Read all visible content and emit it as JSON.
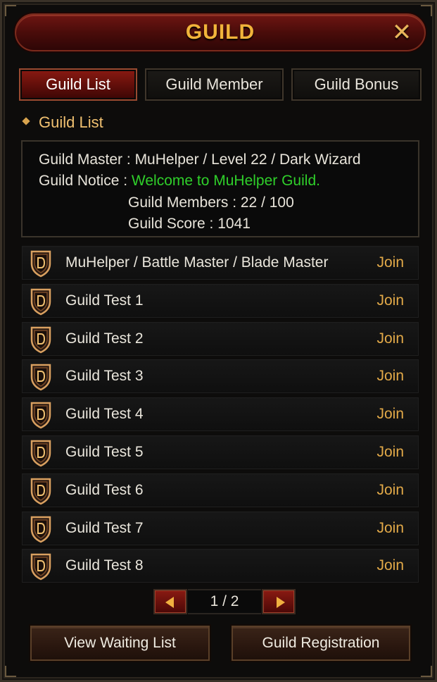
{
  "window": {
    "title": "GUILD",
    "close_symbol": "✕"
  },
  "tabs": [
    {
      "label": "Guild List",
      "active": true
    },
    {
      "label": "Guild Member",
      "active": false
    },
    {
      "label": "Guild Bonus",
      "active": false
    }
  ],
  "section": {
    "title": "Guild List"
  },
  "info": {
    "master_label": "Guild Master :",
    "master_value": "MuHelper / Level 22 / Dark Wizard",
    "notice_label": "Guild Notice :",
    "notice_value": "Welcome to MuHelper Guild.",
    "members_text": "Guild Members : 22 / 100",
    "score_text": "Guild Score : 1041"
  },
  "guilds": [
    {
      "name": "MuHelper / Battle Master / Blade Master",
      "action": "Join"
    },
    {
      "name": "Guild Test 1",
      "action": "Join"
    },
    {
      "name": "Guild Test 2",
      "action": "Join"
    },
    {
      "name": "Guild Test 3",
      "action": "Join"
    },
    {
      "name": "Guild Test 4",
      "action": "Join"
    },
    {
      "name": "Guild Test 5",
      "action": "Join"
    },
    {
      "name": "Guild Test 6",
      "action": "Join"
    },
    {
      "name": "Guild Test 7",
      "action": "Join"
    },
    {
      "name": "Guild Test 8",
      "action": "Join"
    }
  ],
  "pagination": {
    "text": "1 / 2"
  },
  "buttons": {
    "waiting": "View Waiting List",
    "register": "Guild Registration"
  },
  "colors": {
    "gold": "#f2b43a",
    "notice_green": "#2fcf2a",
    "join": "#e2a948",
    "tab_active": "#8a1a12"
  },
  "icons": {
    "guild_emblem": "shield-d-icon",
    "prev": "triangle-left-icon",
    "next": "triangle-right-icon"
  }
}
